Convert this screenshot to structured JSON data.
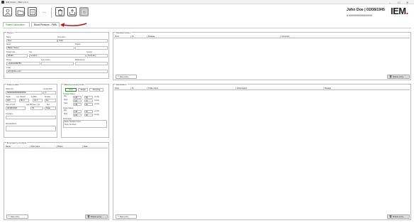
{
  "window": {
    "title": "IEM Studio - IBEX 2.0.4",
    "minimize": "–",
    "maximize": "☐",
    "close": "✕"
  },
  "toolbar": {
    "buttons": [
      {
        "icon": "user-icon"
      },
      {
        "icon": "folder-icon"
      },
      {
        "icon": "database-icon"
      },
      {
        "icon": "trash-icon"
      },
      {
        "icon": "export-icon"
      },
      {
        "icon": "grid-icon"
      }
    ],
    "more": "..."
  },
  "header": {
    "patient_name": "John Doe | 02/08/1945",
    "patient_id": "# 99999999999999999",
    "logo": "IEM",
    "brand_color": "#e30613"
  },
  "tabs": [
    {
      "label": "Patient Information",
      "active": true
    },
    {
      "label": "Blood Pressure - PWA",
      "active": false
    }
  ],
  "person": {
    "title": "Person",
    "name_label": "Name",
    "name": "Doe",
    "first_name_label": "First name",
    "first_name": "John",
    "street_label": "Street",
    "street": "Baker Street",
    "region_label": "Region",
    "region": "",
    "postal_code_label": "Postal code",
    "postal_code": "93445",
    "city_label": "City",
    "city": "London",
    "country_label": "Country",
    "country": "Germany",
    "phone_label": "Phone",
    "phone": "+44012409789",
    "fax_label": "Fax number",
    "fax": "",
    "mobile_label": "Mobilephone",
    "mobile": "",
    "email_label": "email",
    "email": "john@doe.com"
  },
  "patient_data": {
    "title": "Patient data",
    "patient_id_label": "Patient ID",
    "patient_id": "99999999999999999",
    "gender_label": "Gender/PW",
    "gender": "m",
    "height_label": "Height",
    "height": "180",
    "weight_label": "curr. Weight",
    "weight": "80.0",
    "bmi_label": "kg BMI",
    "bmi": "24.7",
    "smoker_label": "Smoker",
    "smoker": "No",
    "dob_label": "Date of birth",
    "dob": "02/08/1945",
    "age_label": "Age PW-Ges. Typ",
    "age": "79",
    "sex_label": "Sex",
    "sex": "Male",
    "insurance_label": "Insurance",
    "insurance": "",
    "remark_label": "Remark/Room",
    "remark": ""
  },
  "bp_limits": {
    "title": "Blood pressure limits",
    "tabs": [
      "ESH",
      "Single",
      "Stepping"
    ],
    "average_label": "Average Values",
    "rows_avg": [
      {
        "label": "Day",
        "sys": "135",
        "dia": "85",
        "unit": "mmHg"
      },
      {
        "label": "Night",
        "sys": "120",
        "dia": "70",
        "unit": "mmHg"
      },
      {
        "label": "Total",
        "sys": "130",
        "dia": "80",
        "unit": "mmHg"
      }
    ],
    "single_label": "Single Values",
    "rows_single": [
      {
        "label": "Day",
        "sys": "140",
        "dia": "90",
        "unit": "mmHg"
      },
      {
        "label": "Night",
        "sys": "125",
        "dia": "80",
        "unit": "mmHg"
      }
    ],
    "info_title": "Information",
    "info_line1": "Mode: Standard / Auto",
    "info_line2": "Study: No Study"
  },
  "emergency": {
    "title": "Emergency contacts",
    "columns": [
      "Name",
      "First name",
      "Phone",
      "Role"
    ],
    "new_entry": "New entry",
    "delete_entry": "Delete entry"
  },
  "medical_history": {
    "title": "Medical history",
    "columns": [
      "From",
      "To",
      "Disease",
      "Comment"
    ],
    "new_entry": "New entry",
    "delete_entry": "Delete entry"
  },
  "medication": {
    "title": "Medication",
    "columns": [
      "From",
      "To",
      "Trade name",
      "Active agent",
      "Dosage"
    ],
    "new_entry": "New entry",
    "delete_entry": "Delete entry"
  },
  "colors": {
    "active_tab": "#2a8a2a",
    "arrow": "#c0141c"
  }
}
